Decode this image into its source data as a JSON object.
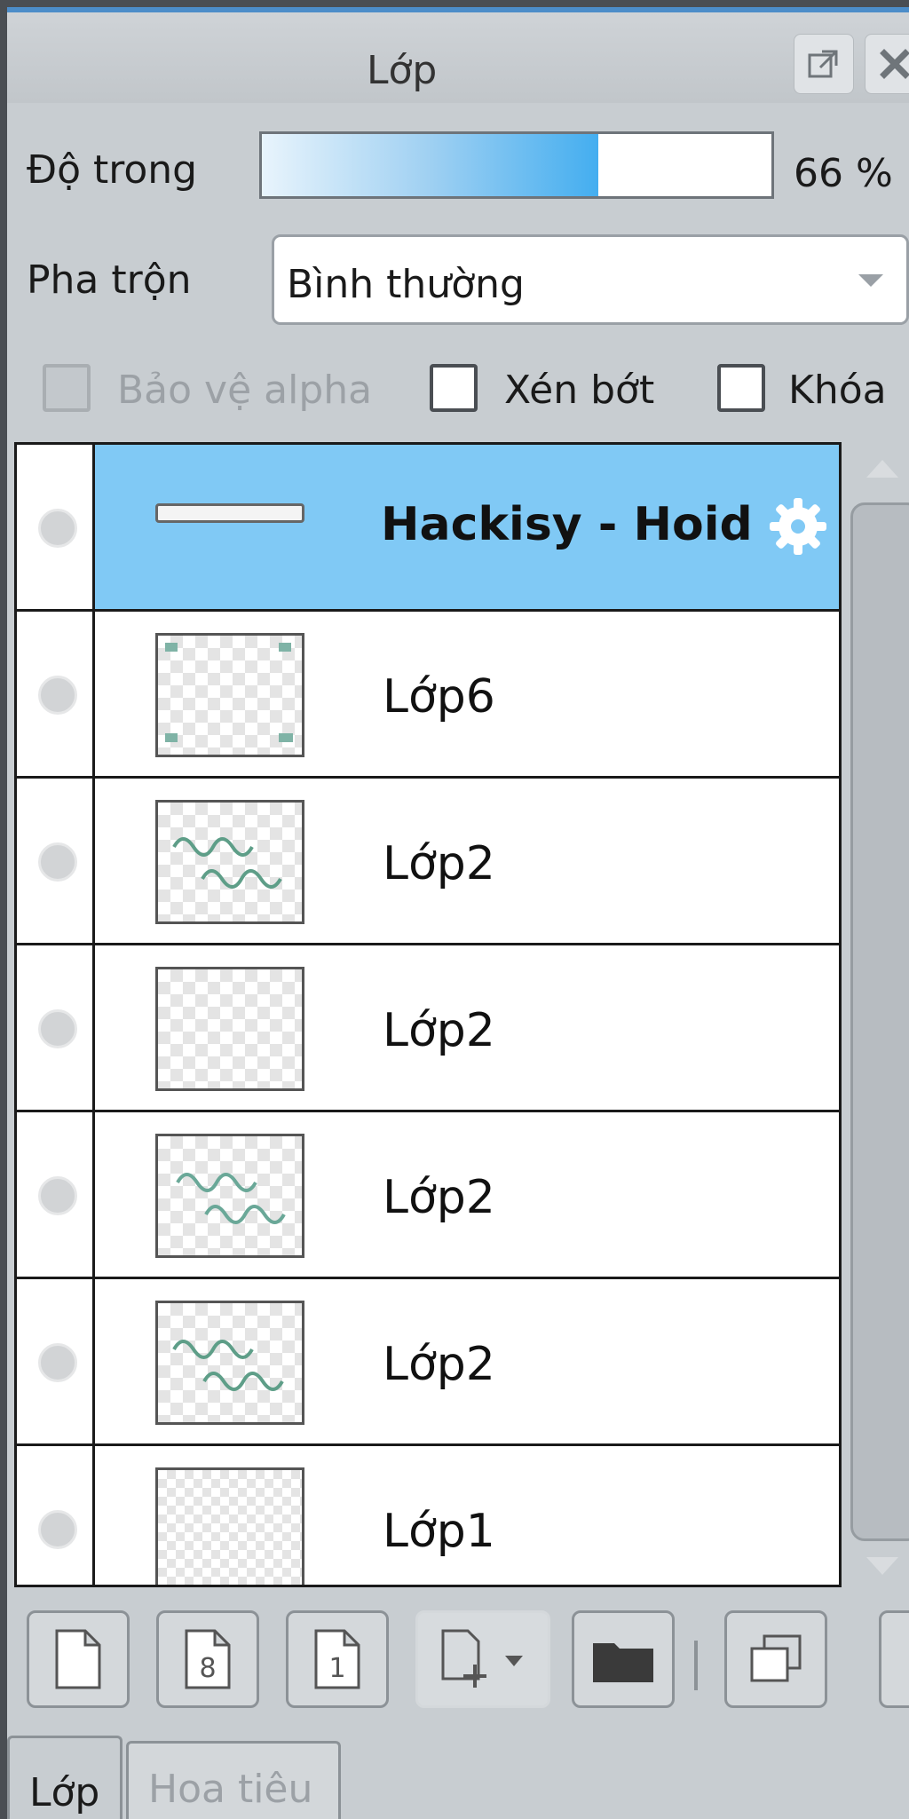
{
  "panel": {
    "title": "Lớp",
    "icons": [
      "popout-icon",
      "close-icon"
    ]
  },
  "opacity": {
    "label": "Độ trong",
    "value_text": "66 %",
    "level": 0.66
  },
  "blend": {
    "label": "Pha trộn",
    "value": "Bình thường"
  },
  "options": {
    "protect_alpha": {
      "label": "Bảo vệ alpha",
      "checked": false,
      "disabled": true
    },
    "clip": {
      "label": "Xén bớt",
      "checked": false
    },
    "lock": {
      "label": "Khóa",
      "checked": false
    }
  },
  "layers": [
    {
      "name": "Hackisy - Hoid",
      "selected": true,
      "thumb": "text-strip"
    },
    {
      "name": "Lớp6",
      "selected": false,
      "thumb": "transparent-corner-marks"
    },
    {
      "name": "Lớp2",
      "selected": false,
      "thumb": "handwriting-green"
    },
    {
      "name": "Lớp2",
      "selected": false,
      "thumb": "transparent-faint"
    },
    {
      "name": "Lớp2",
      "selected": false,
      "thumb": "handwriting-green"
    },
    {
      "name": "Lớp2",
      "selected": false,
      "thumb": "handwriting-green"
    },
    {
      "name": "Lớp1",
      "selected": false,
      "thumb": "grid-pattern"
    }
  ],
  "toolbar": [
    "new-layer-icon",
    "new-8bit-layer-icon",
    "new-1bit-layer-icon",
    "add-layer-dropdown-icon",
    "new-folder-icon",
    "duplicate-layer-icon"
  ],
  "tabs": [
    {
      "label": "Lớp",
      "active": true
    },
    {
      "label": "Hoa tiêu",
      "active": false
    }
  ],
  "colors": {
    "accent": "#4c8dc9",
    "selected_row": "#80c9f5",
    "panel_bg": "#c8cdd1"
  }
}
